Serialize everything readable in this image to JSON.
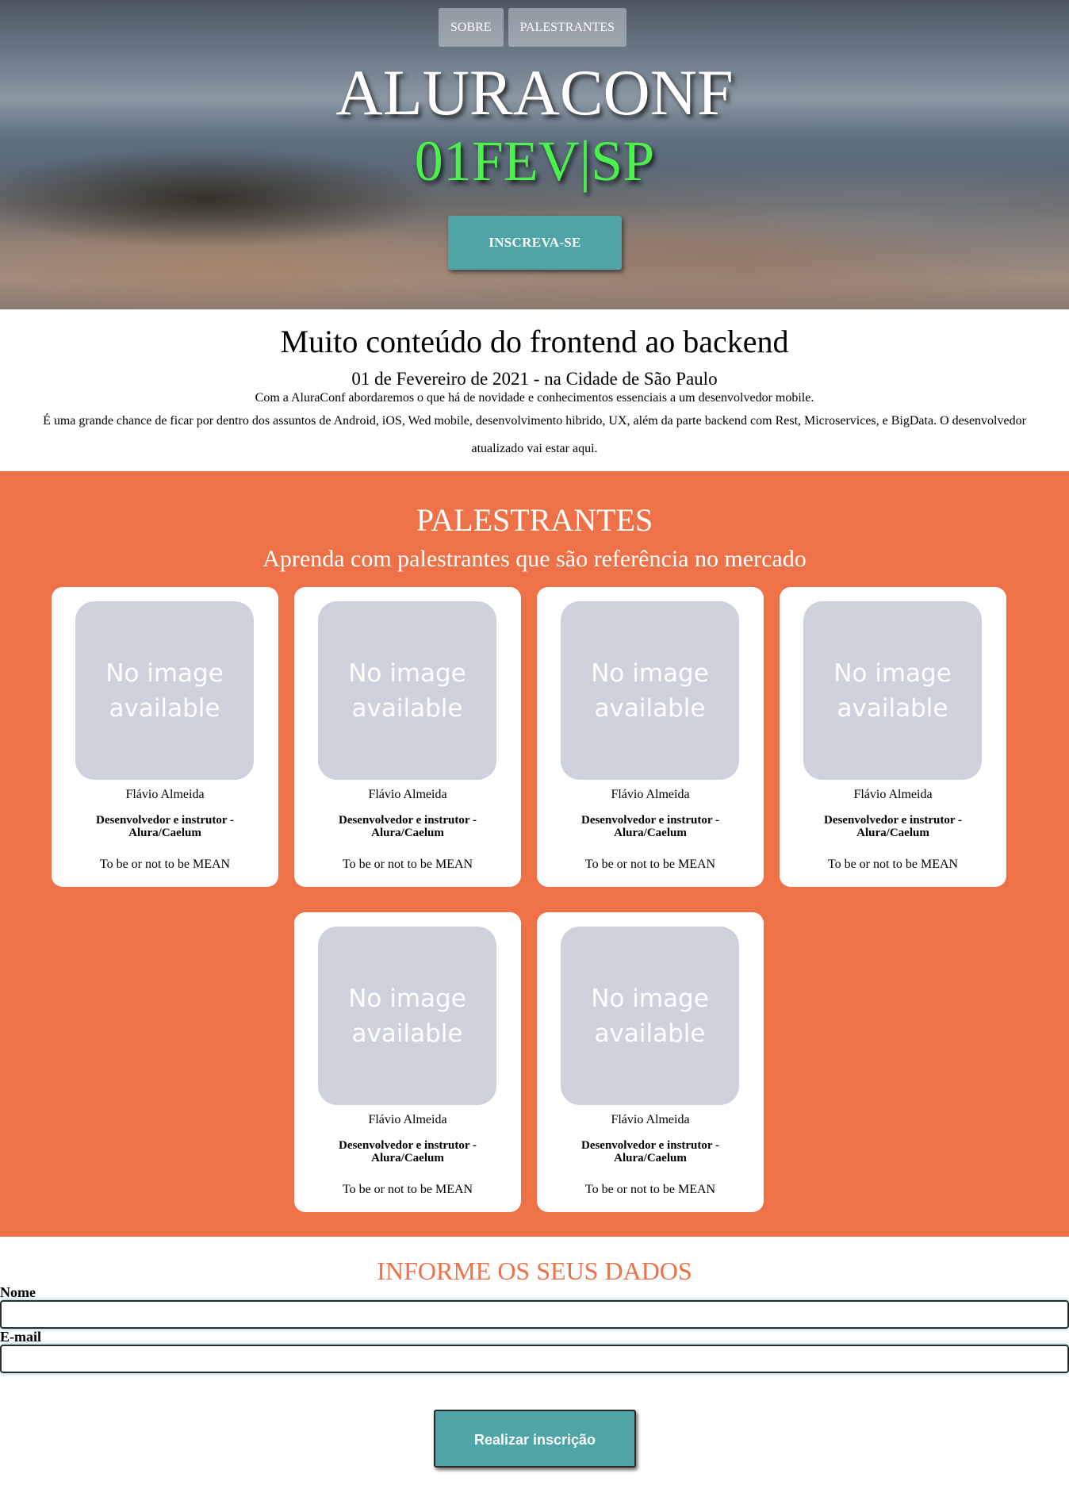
{
  "nav": {
    "items": [
      "SOBRE",
      "PALESTRANTES"
    ]
  },
  "hero": {
    "title": "ALURACONF",
    "date": "01FEV|SP",
    "cta": "INSCREVA-SE"
  },
  "about": {
    "title": "Muito conteúdo do frontend ao backend",
    "subtitle": "01 de Fevereiro de 2021 - na Cidade de São Paulo",
    "text1": "Com a AluraConf abordaremos o que há de novidade e conhecimentos essenciais a um desenvolvedor mobile.",
    "text2": "É uma grande chance de ficar por dentro dos assuntos de Android, iOS, Wed mobile, desenvolvimento hibrido, UX, além da parte backend com Rest, Microservices, e BigData. O desenvolvedor atualizado vai estar aqui."
  },
  "speakers": {
    "title": "PALESTRANTES",
    "subtitle": "Aprenda com palestrantes que são referência no mercado",
    "items": [
      {
        "photo": "No image available",
        "name": "Flávio Almeida",
        "role": "Desenvolvedor e instrutor - Alura/Caelum",
        "talk": "To be or not to be MEAN"
      },
      {
        "photo": "No image available",
        "name": "Flávio Almeida",
        "role": "Desenvolvedor e instrutor - Alura/Caelum",
        "talk": "To be or not to be MEAN"
      },
      {
        "photo": "No image available",
        "name": "Flávio Almeida",
        "role": "Desenvolvedor e instrutor - Alura/Caelum",
        "talk": "To be or not to be MEAN"
      },
      {
        "photo": "No image available",
        "name": "Flávio Almeida",
        "role": "Desenvolvedor e instrutor - Alura/Caelum",
        "talk": "To be or not to be MEAN"
      },
      {
        "photo": "No image available",
        "name": "Flávio Almeida",
        "role": "Desenvolvedor e instrutor - Alura/Caelum",
        "talk": "To be or not to be MEAN"
      },
      {
        "photo": "No image available",
        "name": "Flávio Almeida",
        "role": "Desenvolvedor e instrutor - Alura/Caelum",
        "talk": "To be or not to be MEAN"
      }
    ]
  },
  "form": {
    "title": "INFORME OS SEUS DADOS",
    "name_label": "Nome",
    "name_value": "",
    "email_label": "E-mail",
    "email_value": "",
    "submit": "Realizar inscrição"
  },
  "colors": {
    "accent_orange": "#ef7148",
    "accent_teal": "#4ea4a7",
    "date_green": "#4cf24c",
    "placeholder_gray": "#cfd1dc"
  }
}
